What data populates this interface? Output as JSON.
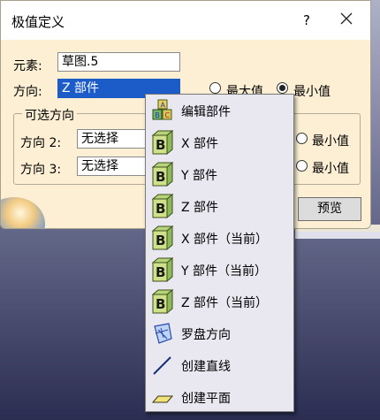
{
  "dialog": {
    "title": "极值定义",
    "help_label": "?",
    "element_label": "元素:",
    "element_value": "草图.5",
    "direction_label": "方向:",
    "direction_value": "Z 部件",
    "max_label": "最大值",
    "min_label": "最小值",
    "optional_group_title": "可选方向",
    "direction2_label": "方向 2:",
    "direction2_value": "无选择",
    "direction2_min_label": "最小值",
    "direction3_label": "方向 3:",
    "direction3_value": "无选择",
    "direction3_min_label": "最小值",
    "preview_label": "预览"
  },
  "context_menu": {
    "items": [
      {
        "label": "编辑部件",
        "icon": "abc-cubes-icon"
      },
      {
        "label": "X 部件",
        "icon": "b-cube-icon"
      },
      {
        "label": "Y 部件",
        "icon": "b-cube-icon"
      },
      {
        "label": "Z 部件",
        "icon": "b-cube-icon"
      },
      {
        "label": "X 部件（当前）",
        "icon": "b-cube-icon"
      },
      {
        "label": "Y 部件（当前）",
        "icon": "b-cube-icon"
      },
      {
        "label": "Z 部件（当前）",
        "icon": "b-cube-icon"
      },
      {
        "label": "罗盘方向",
        "icon": "compass-icon"
      },
      {
        "label": "创建直线",
        "icon": "line-icon"
      },
      {
        "label": "创建平面",
        "icon": "plane-icon"
      }
    ]
  },
  "colors": {
    "dialog_bg": "#fcefd4",
    "selection": "#1c5cc9",
    "menu_bg": "#e9e7f0"
  }
}
